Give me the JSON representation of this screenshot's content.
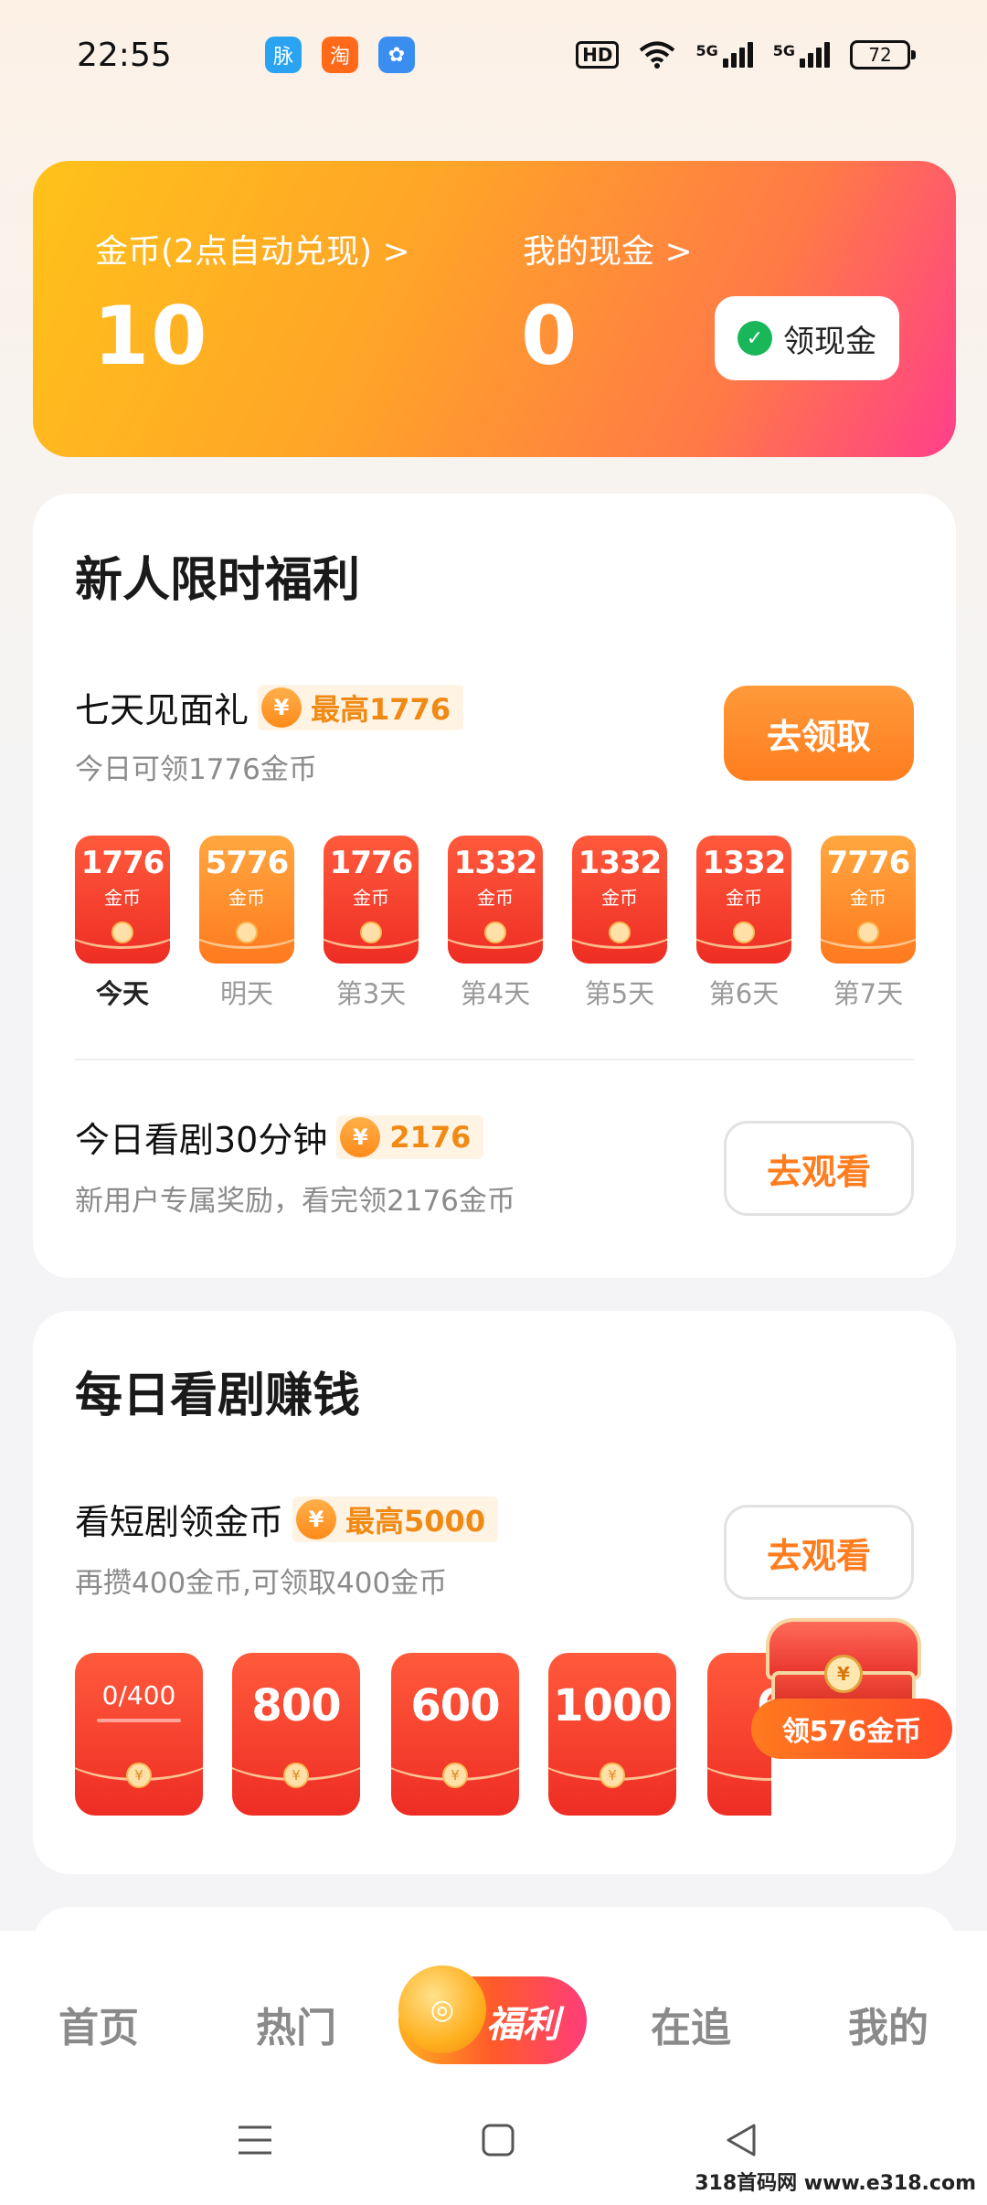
{
  "status_bar": {
    "time": "22:55",
    "apps": [
      {
        "icon": "maimai-app-icon",
        "glyph": "脉",
        "color": "#2aa4f0"
      },
      {
        "icon": "taobao-app-icon",
        "glyph": "淘",
        "color": "#ff6a1a"
      },
      {
        "icon": "pinwheel-app-icon",
        "glyph": "✿",
        "color": "#3a8ef0"
      }
    ],
    "hd": "HD",
    "net1": "5G",
    "net2": "5G",
    "battery": "72"
  },
  "coins_card": {
    "coins_label": "金币(2点自动兑现) >",
    "coins_value": "10",
    "cash_label": "我的现金 >",
    "cash_value": "0",
    "withdraw_button": "领现金"
  },
  "newcomer": {
    "title": "新人限时福利",
    "seven_day": {
      "title": "七天见面礼",
      "badge": "最高1776",
      "subtitle": "今日可领1776金币",
      "button": "去领取",
      "days": [
        {
          "amount": "1776",
          "unit": "金币",
          "label": "今天",
          "style": "red"
        },
        {
          "amount": "5776",
          "unit": "金币",
          "label": "明天",
          "style": "orange"
        },
        {
          "amount": "1776",
          "unit": "金币",
          "label": "第3天",
          "style": "red"
        },
        {
          "amount": "1332",
          "unit": "金币",
          "label": "第4天",
          "style": "red"
        },
        {
          "amount": "1332",
          "unit": "金币",
          "label": "第5天",
          "style": "red"
        },
        {
          "amount": "1332",
          "unit": "金币",
          "label": "第6天",
          "style": "red"
        },
        {
          "amount": "7776",
          "unit": "金币",
          "label": "第7天",
          "style": "orange"
        }
      ]
    },
    "watch_today": {
      "title": "今日看剧30分钟",
      "badge": "2176",
      "subtitle": "新用户专属奖励，看完领2176金币",
      "button": "去观看"
    }
  },
  "daily": {
    "title": "每日看剧赚钱",
    "task": {
      "title": "看短剧领金币",
      "badge": "最高5000",
      "subtitle": "再攒400金币,可领取400金币",
      "button": "去观看"
    },
    "progress_text": "0/400",
    "progress_fraction": 0,
    "rewards": [
      "800",
      "600",
      "1000",
      "6"
    ],
    "chest_label": "领576金币"
  },
  "tabs": {
    "home": "首页",
    "hot": "热门",
    "welfare": "福利",
    "following": "在追",
    "mine": "我的"
  },
  "watermark": "318首码网 www.e318.com"
}
